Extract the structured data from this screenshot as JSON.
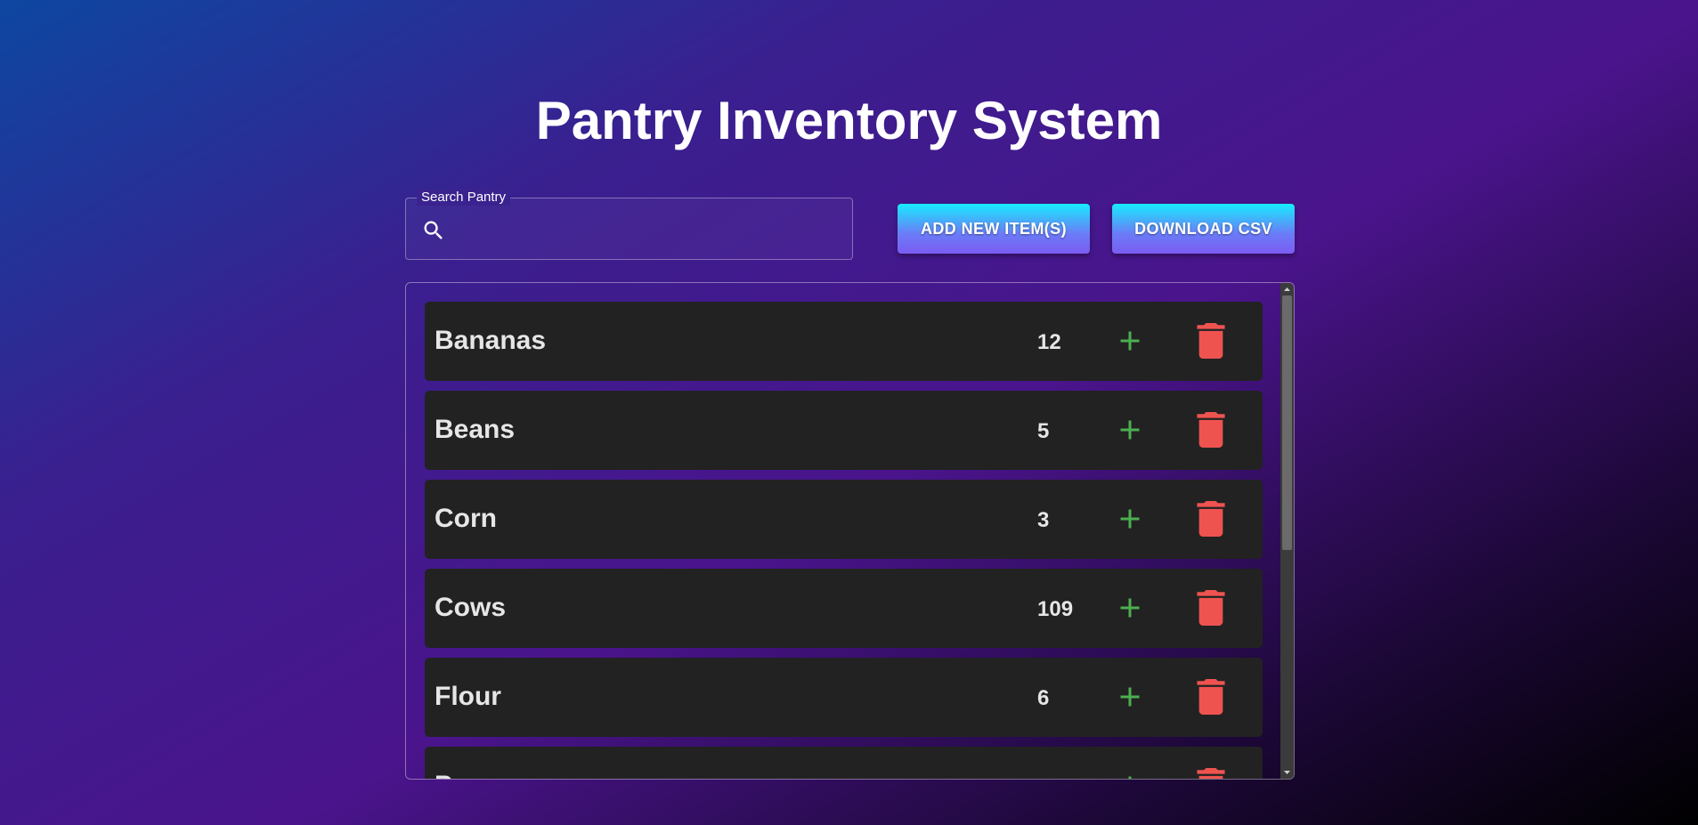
{
  "header": {
    "title": "Pantry Inventory System"
  },
  "search": {
    "label": "Search Pantry",
    "placeholder": "",
    "value": "",
    "icon": "search-icon"
  },
  "toolbar": {
    "add_label": "ADD NEW ITEM(S)",
    "download_label": "DOWNLOAD CSV"
  },
  "inventory": {
    "items": [
      {
        "name": "Bananas",
        "quantity": "12"
      },
      {
        "name": "Beans",
        "quantity": "5"
      },
      {
        "name": "Corn",
        "quantity": "3"
      },
      {
        "name": "Cows",
        "quantity": "109"
      },
      {
        "name": "Flour",
        "quantity": "6"
      },
      {
        "name": "P",
        "quantity": ""
      }
    ]
  },
  "icons": {
    "increment": "plus-icon",
    "delete": "trash-icon"
  },
  "colors": {
    "plus": "#4caf50",
    "trash": "#ef5350",
    "row_bg": "#222222",
    "button_top": "#18ecff",
    "button_bottom": "#7b5cf2"
  }
}
